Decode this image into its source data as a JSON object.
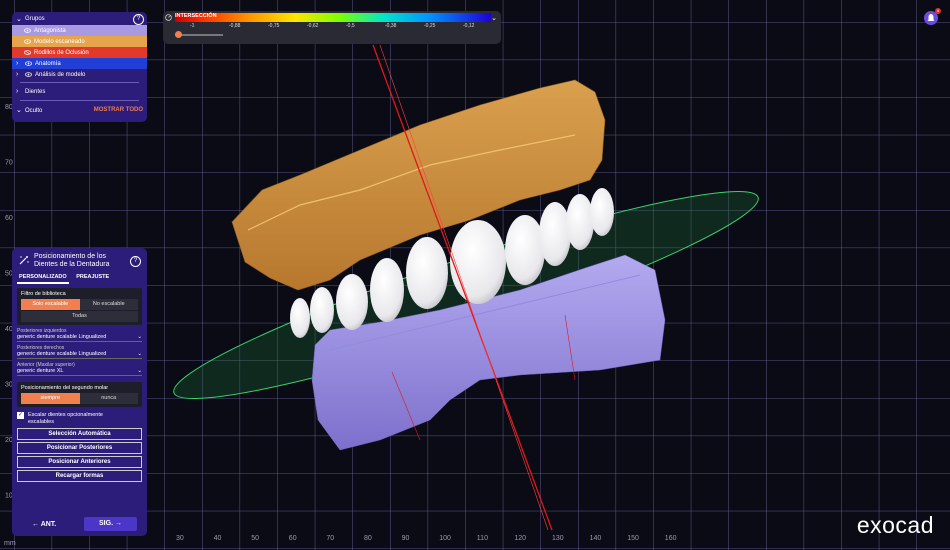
{
  "groups": {
    "title": "Grupos",
    "items": [
      {
        "label": "Antagonista",
        "bg": "#a89ae0"
      },
      {
        "label": "Modelo escaneado",
        "bg": "#e6a44c"
      },
      {
        "label": "Rodillos de Oclusión",
        "bg": "#e23a2a"
      },
      {
        "label": "Anatomía",
        "bg": "#1f3fd6"
      },
      {
        "label": "Análisis de modelo",
        "bg": "#2c1d7a"
      }
    ],
    "dientes": "Dientes",
    "oculto": "Oculto",
    "mostrar_todo": "MOSTRAR TODO"
  },
  "intersection": {
    "label": "INTERSECCIÓN",
    "ticks": [
      "-1",
      "-0,88",
      "-0,75",
      "-0,62",
      "-0,5",
      "-0,38",
      "-0,25",
      "-0,12"
    ]
  },
  "panel": {
    "title_line1": "Posicionamiento de los",
    "title_line2": "Dientes de la Dentadura",
    "tab_custom": "PERSONALIZADO",
    "tab_preset": "PREAJUSTE",
    "filter_label": "Filtro de biblioteca",
    "filter_scalable": "Solo escalable",
    "filter_nonscalable": "No escalable",
    "filter_all": "Todas",
    "post_left_label": "Posteriores izquierdos",
    "post_left_value": "generic denture scalable Lingualized",
    "post_right_label": "Posteriores derechos",
    "post_right_value": "generic denture scalable Lingualized",
    "anterior_label": "Anterior (Maxilar superior)",
    "anterior_value": "generic denture XL",
    "second_molar_label": "Posicionamiento del segundo molar",
    "always": "siempre",
    "never": "nunca",
    "scale_teeth_line1": "Escalar dientes opcionalmente",
    "scale_teeth_line2": "escalables",
    "btn_auto": "Selección Automática",
    "btn_post": "Posicionar Posteriores",
    "btn_ant": "Posicionar Anteriores",
    "btn_reload": "Recargar formas",
    "prev": "ANT.",
    "next": "SIG."
  },
  "ruler": {
    "unit": "mm",
    "x_labels": [
      "30",
      "40",
      "50",
      "60",
      "70",
      "80",
      "90",
      "100",
      "110",
      "120",
      "130",
      "140",
      "150",
      "160"
    ],
    "y_labels": [
      "80",
      "70",
      "60",
      "50",
      "40",
      "30",
      "20",
      "10"
    ]
  },
  "logo": "exocad",
  "notifications_count": "4"
}
